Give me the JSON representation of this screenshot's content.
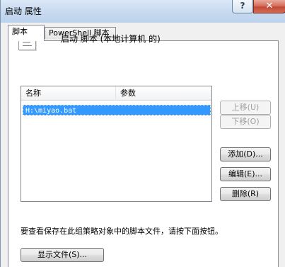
{
  "window": {
    "title": "启动 属性",
    "help_glyph": "?",
    "close_glyph": "✕"
  },
  "tabs": [
    {
      "label": "脚本",
      "active": true
    },
    {
      "label": "PowerShell 脚本",
      "active": false
    }
  ],
  "heading": "启动 脚本 (本地计算机 的)",
  "list": {
    "columns": [
      "名称",
      "参数"
    ],
    "rows": [
      {
        "name": "H:\\miyao.bat",
        "params": "",
        "selected": true
      }
    ]
  },
  "buttons": {
    "move_up": "上移(U)",
    "move_down": "下移(O)",
    "add": "添加(D)...",
    "edit": "编辑(E)...",
    "delete": "删除(R)",
    "show_files": "显示文件(S)..."
  },
  "info_text": "要查看保存在此组策略对象中的脚本文件，请按下面按钮。",
  "colors": {
    "selection": "#3399ff",
    "close_button": "#c24a35",
    "titlebar": "#c6d9ef"
  },
  "icons": {
    "file": "script-file-icon"
  }
}
